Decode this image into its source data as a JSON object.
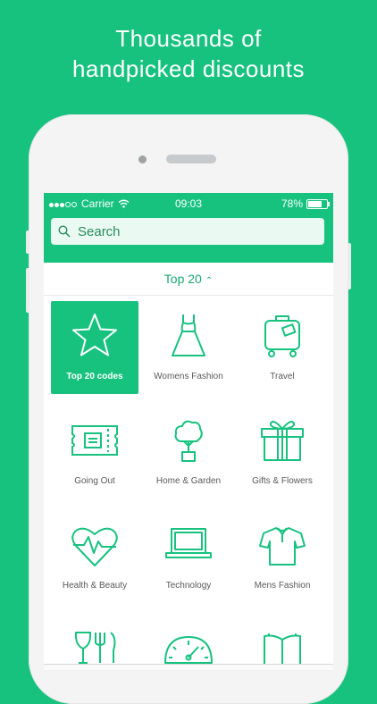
{
  "headline": {
    "line1": "Thousands of",
    "line2": "handpicked discounts"
  },
  "status_bar": {
    "carrier": "Carrier",
    "time": "09:03",
    "battery": "78%"
  },
  "search": {
    "placeholder": "Search"
  },
  "segment": {
    "label": "Top 20",
    "chevron": "⌃"
  },
  "categories": [
    {
      "label": "Top 20 codes",
      "icon": "star-icon"
    },
    {
      "label": "Womens Fashion",
      "icon": "dress-icon"
    },
    {
      "label": "Travel",
      "icon": "suitcase-icon"
    },
    {
      "label": "Going Out",
      "icon": "ticket-icon"
    },
    {
      "label": "Home & Garden",
      "icon": "plant-icon"
    },
    {
      "label": "Gifts & Flowers",
      "icon": "gift-icon"
    },
    {
      "label": "Health & Beauty",
      "icon": "heart-pulse-icon"
    },
    {
      "label": "Technology",
      "icon": "laptop-icon"
    },
    {
      "label": "Mens Fashion",
      "icon": "shirt-icon"
    },
    {
      "label": "",
      "icon": "food-drink-icon"
    },
    {
      "label": "",
      "icon": "speedometer-icon"
    },
    {
      "label": "",
      "icon": "book-icon"
    }
  ],
  "colors": {
    "brand": "#17c27f",
    "icon_stroke": "#17c27f",
    "label_text": "#595959"
  }
}
